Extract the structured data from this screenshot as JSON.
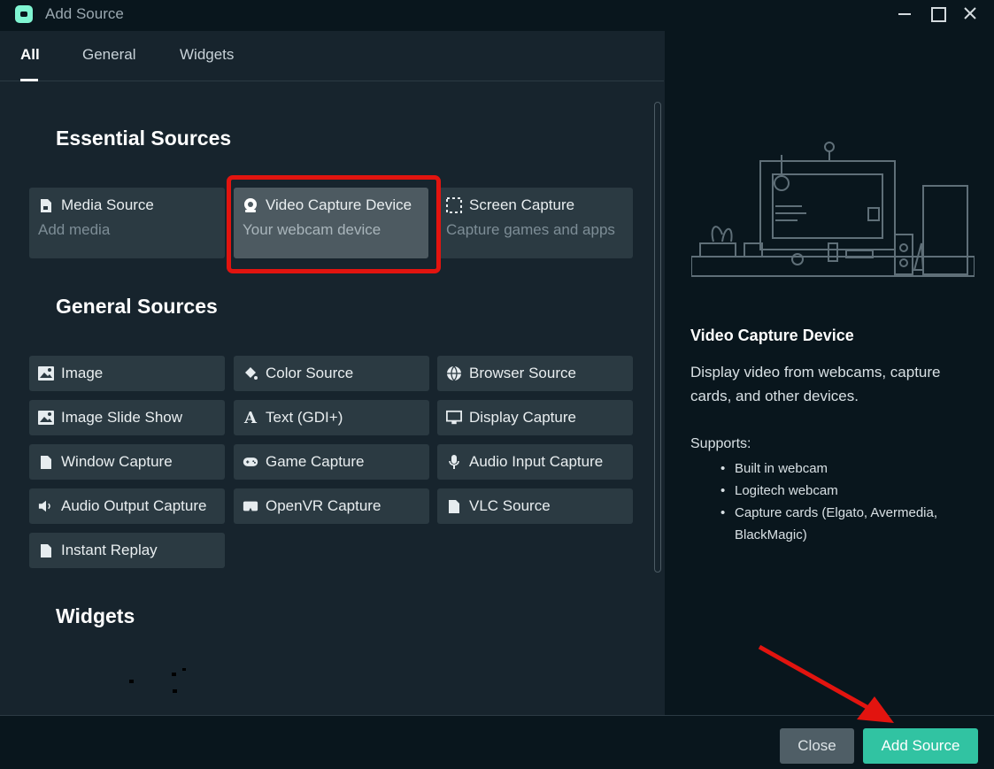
{
  "window": {
    "title": "Add Source"
  },
  "tabs": [
    {
      "label": "All"
    },
    {
      "label": "General"
    },
    {
      "label": "Widgets"
    }
  ],
  "sections": {
    "essential": "Essential Sources",
    "general": "General Sources",
    "widgets": "Widgets"
  },
  "essential_sources": [
    {
      "title": "Media Source",
      "subtitle": "Add media",
      "icon": "file-video-icon"
    },
    {
      "title": "Video Capture Device",
      "subtitle": "Your webcam device",
      "icon": "webcam-icon",
      "selected": true
    },
    {
      "title": "Screen Capture",
      "subtitle": "Capture games and apps",
      "icon": "screen-capture-icon"
    }
  ],
  "general_sources": [
    {
      "label": "Image",
      "icon": "image-icon"
    },
    {
      "label": "Color Source",
      "icon": "paint-bucket-icon"
    },
    {
      "label": "Browser Source",
      "icon": "globe-icon"
    },
    {
      "label": "Image Slide Show",
      "icon": "image-icon"
    },
    {
      "label": "Text (GDI+)",
      "icon": "text-icon"
    },
    {
      "label": "Display Capture",
      "icon": "monitor-icon"
    },
    {
      "label": "Window Capture",
      "icon": "file-icon"
    },
    {
      "label": "Game Capture",
      "icon": "gamepad-icon"
    },
    {
      "label": "Audio Input Capture",
      "icon": "microphone-icon"
    },
    {
      "label": "Audio Output Capture",
      "icon": "speaker-icon"
    },
    {
      "label": "OpenVR Capture",
      "icon": "vr-headset-icon"
    },
    {
      "label": "VLC Source",
      "icon": "file-icon"
    },
    {
      "label": "Instant Replay",
      "icon": "file-icon"
    }
  ],
  "details": {
    "title": "Video Capture Device",
    "description": "Display video from webcams, capture cards, and other devices.",
    "supports_label": "Supports:",
    "supports": [
      "Built in webcam",
      "Logitech webcam",
      "Capture cards (Elgato, Avermedia, BlackMagic)"
    ]
  },
  "footer": {
    "close_label": "Close",
    "add_label": "Add Source"
  },
  "colors": {
    "accent": "#31c3a2",
    "highlight": "#e2140f",
    "panel": "#17242d",
    "dark": "#09161d"
  }
}
